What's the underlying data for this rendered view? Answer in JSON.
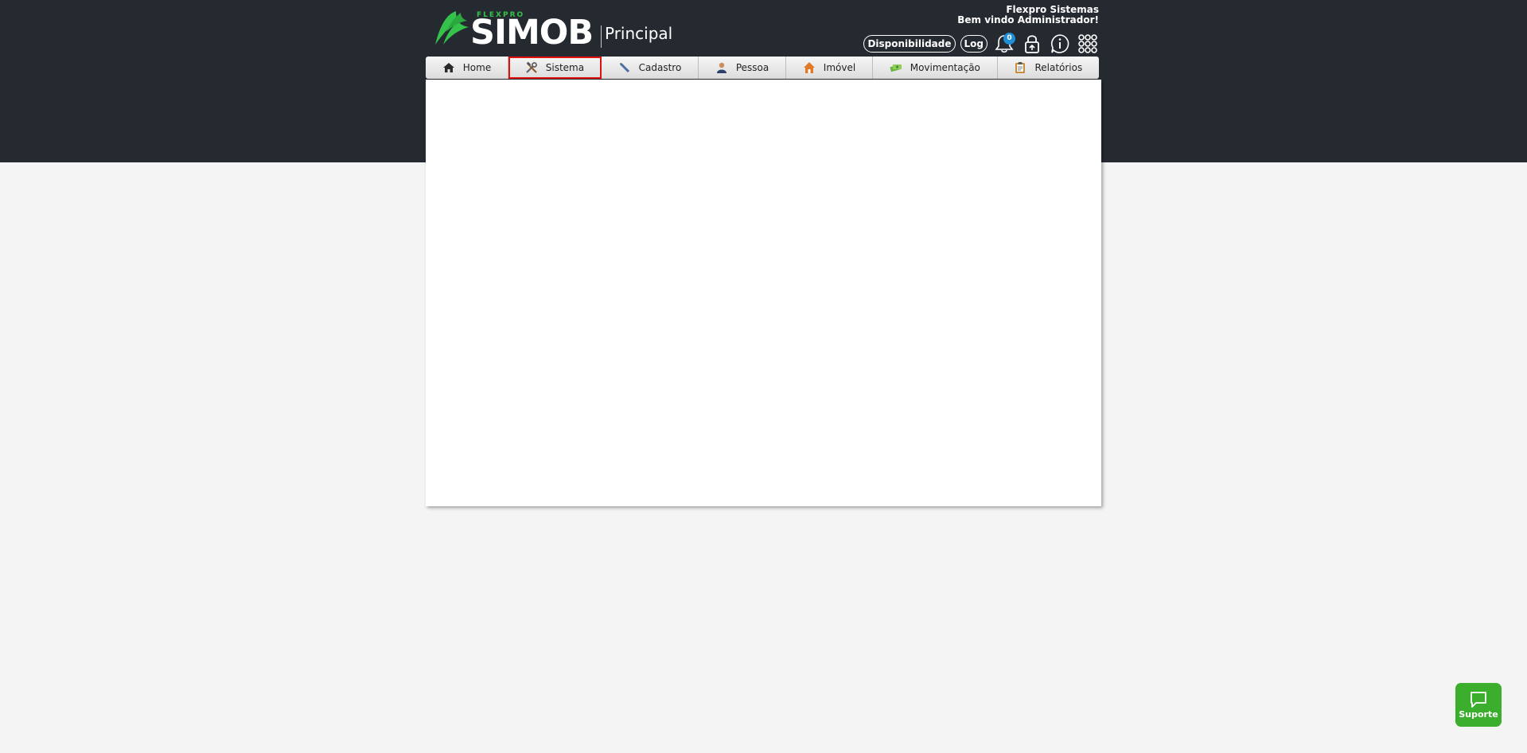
{
  "header": {
    "brand_small": "FLEXPRO",
    "brand_big": "SIMOB",
    "module": "Principal",
    "company": "Flexpro Sistemas",
    "welcome": "Bem vindo Administrador!",
    "disponibilidade": "Disponibilidade",
    "log": "Log",
    "notification_count": "0",
    "icons": [
      "bell-icon",
      "lock-icon",
      "info-icon",
      "apps-grid-icon"
    ]
  },
  "menu": {
    "items": [
      {
        "label": "Home",
        "icon": "home-icon"
      },
      {
        "label": "Sistema",
        "icon": "tools-icon",
        "selected": true
      },
      {
        "label": "Cadastro",
        "icon": "pen-icon"
      },
      {
        "label": "Pessoa",
        "icon": "person-icon"
      },
      {
        "label": "Imóvel",
        "icon": "house-icon"
      },
      {
        "label": "Movimentação",
        "icon": "money-icon"
      },
      {
        "label": "Relatórios",
        "icon": "clipboard-icon"
      }
    ]
  },
  "support": {
    "label": "Suporte",
    "icon": "chat-icon"
  },
  "colors": {
    "header_bg": "#252a31",
    "page_bg": "#f4f4f4",
    "brand_green": "#34c24a",
    "support_green": "#3cae2e",
    "badge_blue": "#1e8fd6",
    "selected_outline": "#e01010"
  }
}
